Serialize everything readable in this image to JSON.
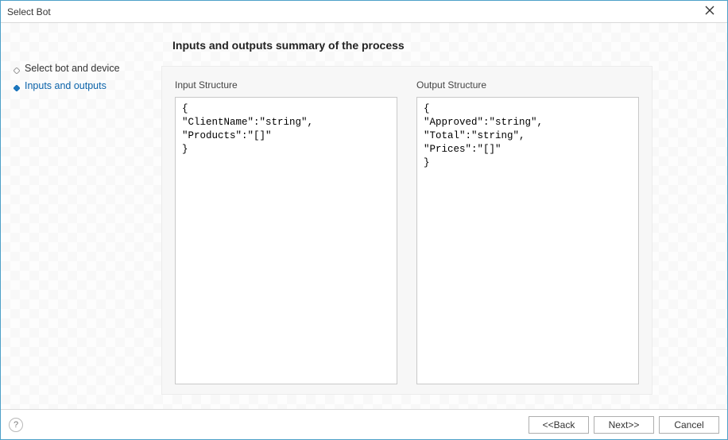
{
  "window": {
    "title": "Select Bot"
  },
  "wizard": {
    "steps": [
      {
        "label": "Select bot and device",
        "active": false
      },
      {
        "label": "Inputs and outputs",
        "active": true
      }
    ]
  },
  "main": {
    "heading": "Inputs and outputs summary of the process",
    "input_label": "Input Structure",
    "output_label": "Output Structure",
    "input_structure": "{\n\"ClientName\":\"string\",\n\"Products\":\"[]\"\n}",
    "output_structure": "{\n\"Approved\":\"string\",\n\"Total\":\"string\",\n\"Prices\":\"[]\"\n}"
  },
  "footer": {
    "back": "<<Back",
    "next": "Next>>",
    "cancel": "Cancel"
  }
}
